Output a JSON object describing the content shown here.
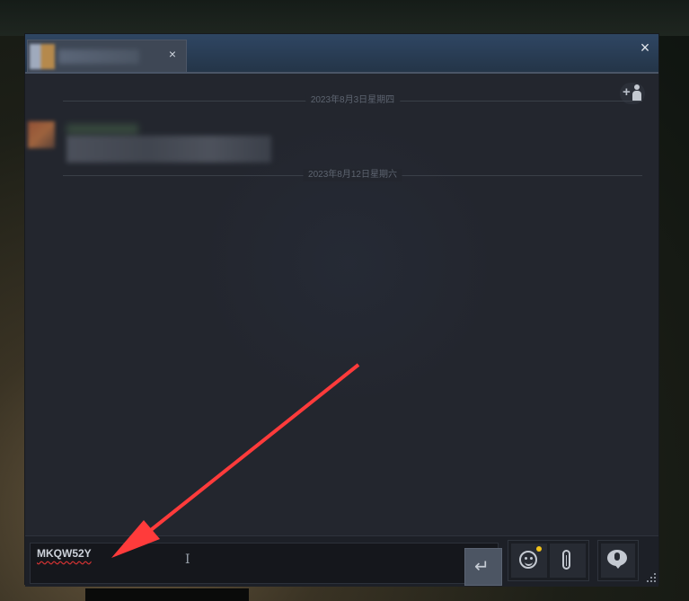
{
  "chat_window": {
    "tab_close_glyph": "×",
    "window_close_glyph": "×",
    "date_separators": [
      "2023年8月3日星期四",
      "2023年8月12日星期六"
    ],
    "add_friend_glyph": "+",
    "input_text": "MKQW52Y",
    "send_glyph": "↵",
    "notification_color": "#f2c21a"
  },
  "annotation": {
    "arrow_color": "#ff3b3b"
  }
}
